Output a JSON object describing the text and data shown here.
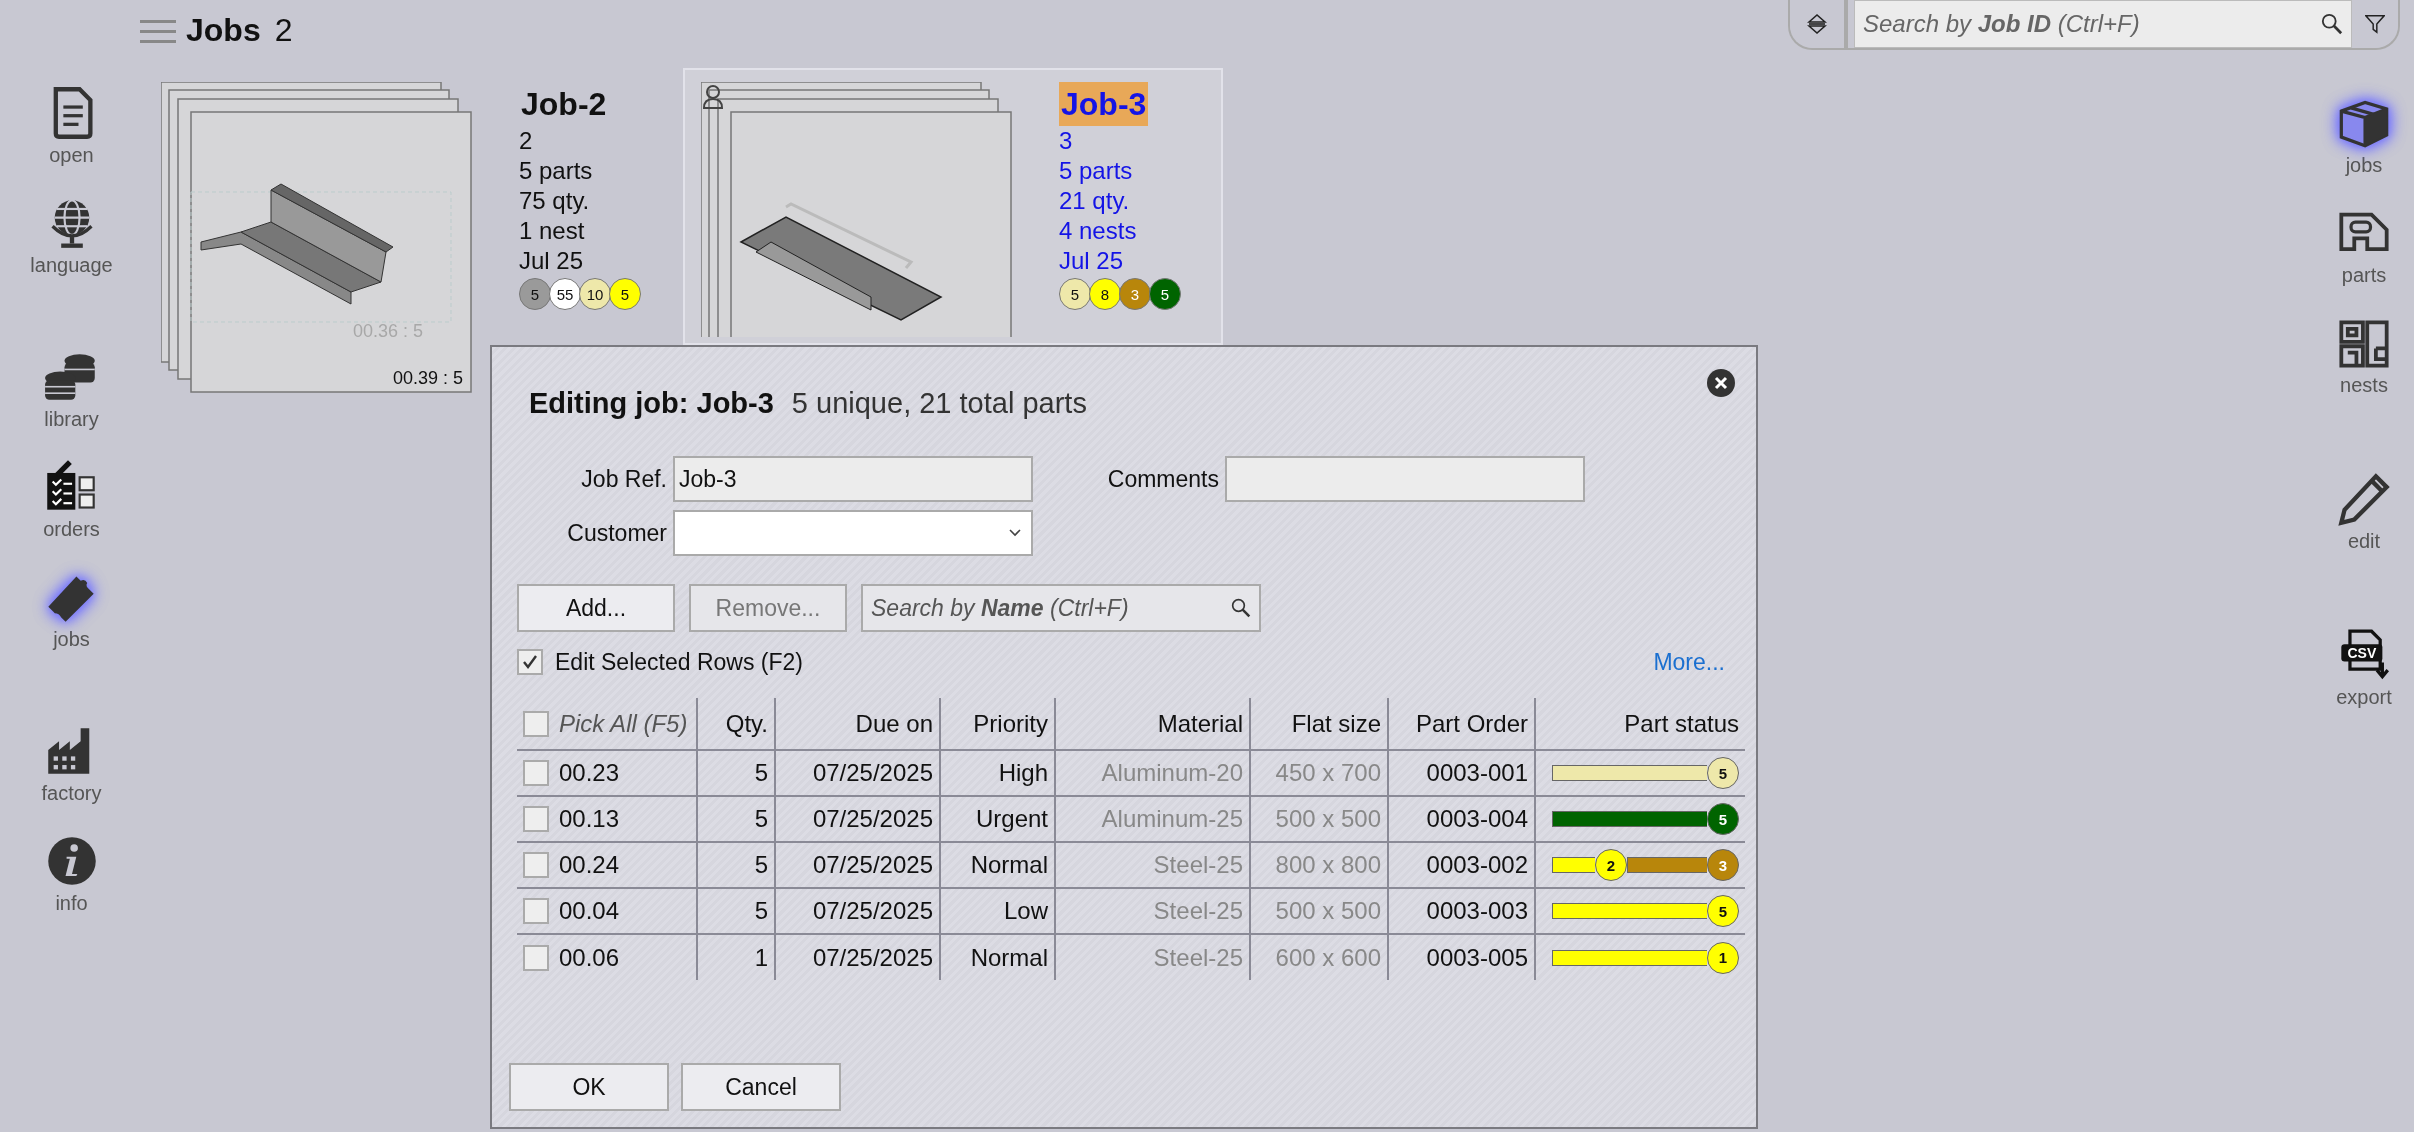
{
  "header": {
    "title": "Jobs",
    "count": "2"
  },
  "search": {
    "placeholder": "Search by **Job ID** (Ctrl+F)"
  },
  "left_nav": {
    "groups": [
      {
        "items": [
          {
            "label": "open",
            "selected": false
          },
          {
            "label": "language",
            "selected": false
          }
        ]
      },
      {
        "items": [
          {
            "label": "library",
            "selected": false
          },
          {
            "label": "orders",
            "selected": false
          },
          {
            "label": "jobs",
            "selected": true
          }
        ]
      },
      {
        "items": [
          {
            "label": "factory",
            "selected": false
          },
          {
            "label": "info",
            "selected": false
          }
        ]
      }
    ]
  },
  "right_nav": {
    "groups": [
      {
        "items": [
          {
            "label": "jobs",
            "selected": true
          },
          {
            "label": "parts",
            "selected": false
          },
          {
            "label": "nests",
            "selected": false
          }
        ]
      },
      {
        "items": [
          {
            "label": "edit",
            "selected": false
          }
        ]
      },
      {
        "items": [
          {
            "label": "export",
            "icon_text": "CSV",
            "selected": false
          }
        ]
      }
    ]
  },
  "cards": [
    {
      "title": "Job-2",
      "number": "2",
      "parts": "5 parts",
      "quantity": "75 qty.",
      "nests": "1 nest",
      "date": "Jul 25",
      "selected": false,
      "user_marker": false,
      "sheet_labels": [
        "00.36 : 5",
        "00.39 : 5"
      ],
      "badges": [
        {
          "count": "5",
          "color": "#9a9a9a"
        },
        {
          "count": "55",
          "color": "#ffffff"
        },
        {
          "count": "10",
          "color": "#eee8aa"
        },
        {
          "count": "5",
          "color": "#ffff00"
        }
      ]
    },
    {
      "title": "Job-3",
      "number": "3",
      "parts": "5 parts",
      "quantity": "21 qty.",
      "nests": "4 nests",
      "date": "Jul 25",
      "selected": true,
      "user_marker": true,
      "badges": [
        {
          "count": "5",
          "color": "#eee8aa"
        },
        {
          "count": "8",
          "color": "#ffff00"
        },
        {
          "count": "3",
          "color": "#b8860b"
        },
        {
          "count": "5",
          "color": "#006400"
        }
      ]
    }
  ],
  "dialog": {
    "title": "Editing job: Job-3",
    "subtitle": "5 unique, 21 total parts",
    "job_ref": {
      "label": "Job Ref.",
      "value": "Job-3"
    },
    "comments": {
      "label": "Comments"
    },
    "customer": {
      "label": "Customer"
    },
    "add_button": {
      "label": "Add...",
      "disabled": false
    },
    "remove_button": {
      "label": "Remove...",
      "disabled": true
    },
    "name_search": {
      "placeholder": "Search by **Name** (Ctrl+F)"
    },
    "edit_selected": {
      "label": "Edit Selected Rows (F2)",
      "checked": true
    },
    "more_link": "More...",
    "table": {
      "pick_all": {
        "label": "Pick All (F5)",
        "checked": false
      },
      "columns": [
        "Qty.",
        "Due on",
        "Priority",
        "Material",
        "Flat size",
        "Part Order",
        "Part status"
      ],
      "rows": [
        {
          "checked": false,
          "name": "00.23",
          "qty": "5",
          "due": "07/25/2025",
          "priority": "High",
          "material": "Aluminum-20",
          "flat_size": "450 x 700",
          "part_order": "0003-001",
          "status": [
            {
              "count": "5",
              "color": "#eee8aa"
            }
          ]
        },
        {
          "checked": false,
          "name": "00.13",
          "qty": "5",
          "due": "07/25/2025",
          "priority": "Urgent",
          "material": "Aluminum-25",
          "flat_size": "500 x 500",
          "part_order": "0003-004",
          "status": [
            {
              "count": "5",
              "color": "#006400"
            }
          ]
        },
        {
          "checked": false,
          "name": "00.24",
          "qty": "5",
          "due": "07/25/2025",
          "priority": "Normal",
          "material": "Steel-25",
          "flat_size": "800 x 800",
          "part_order": "0003-002",
          "status": [
            {
              "count": "2",
              "color": "#ffff00"
            },
            {
              "count": "3",
              "color": "#b8860b"
            }
          ]
        },
        {
          "checked": false,
          "name": "00.04",
          "qty": "5",
          "due": "07/25/2025",
          "priority": "Low",
          "material": "Steel-25",
          "flat_size": "500 x 500",
          "part_order": "0003-003",
          "status": [
            {
              "count": "5",
              "color": "#ffff00"
            }
          ]
        },
        {
          "checked": false,
          "name": "00.06",
          "qty": "1",
          "due": "07/25/2025",
          "priority": "Normal",
          "material": "Steel-25",
          "flat_size": "600 x 600",
          "part_order": "0003-005",
          "status": [
            {
              "count": "1",
              "color": "#ffff00"
            }
          ]
        }
      ]
    },
    "footer_buttons": [
      "OK",
      "Cancel"
    ]
  }
}
